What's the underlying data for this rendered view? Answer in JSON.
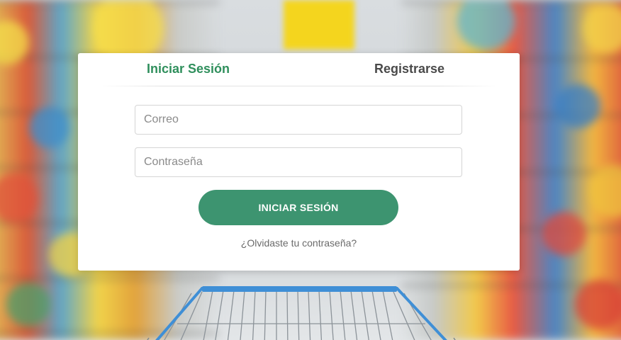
{
  "tabs": {
    "login_label": "Iniciar Sesión",
    "register_label": "Registrarse"
  },
  "form": {
    "email_placeholder": "Correo",
    "email_value": "",
    "password_placeholder": "Contraseña",
    "password_value": "",
    "submit_label": "INICIAR SESIÓN",
    "forgot_label": "¿Olvidaste tu contraseña?"
  },
  "colors": {
    "accent": "#2f8f5c",
    "button": "#3d9470",
    "inactive_tab": "#4a4a4a",
    "card_background": "#ffffff",
    "cart_frame": "#3f8fd6"
  }
}
